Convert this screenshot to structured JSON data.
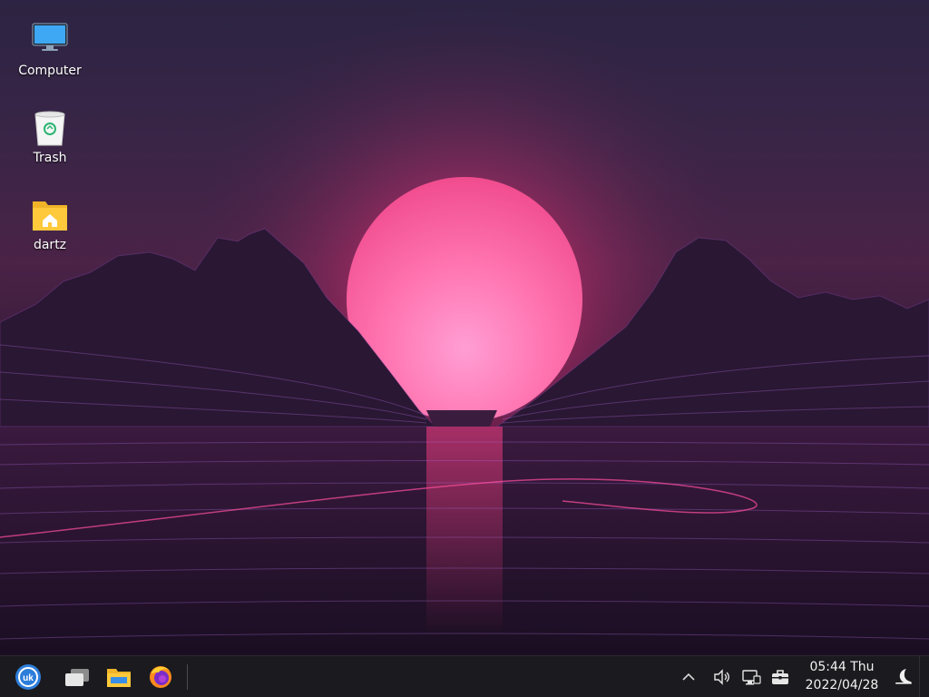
{
  "desktop": {
    "icons": [
      {
        "label": "Computer",
        "icon": "monitor-icon"
      },
      {
        "label": "Trash",
        "icon": "trash-icon"
      },
      {
        "label": "dartz",
        "icon": "home-folder-icon"
      }
    ]
  },
  "taskbar": {
    "apps": [
      {
        "name": "start-menu",
        "icon": "launcher-icon"
      },
      {
        "name": "multitask-view",
        "icon": "windows-icon"
      },
      {
        "name": "file-manager",
        "icon": "folder-icon"
      },
      {
        "name": "firefox",
        "icon": "firefox-icon"
      }
    ],
    "tray": [
      {
        "name": "show-hidden-icons",
        "icon": "chevron-up-icon"
      },
      {
        "name": "volume",
        "icon": "speaker-icon"
      },
      {
        "name": "network",
        "icon": "network-icon"
      },
      {
        "name": "toolbox",
        "icon": "briefcase-icon"
      }
    ],
    "clock": {
      "time": "05:44 Thu",
      "date": "2022/04/28"
    },
    "night_mode_icon": "moon-icon"
  },
  "colors": {
    "taskbar_bg": "#1b1b1f",
    "sun": "#ff6fa8",
    "accent_blue": "#3a8ee6"
  }
}
